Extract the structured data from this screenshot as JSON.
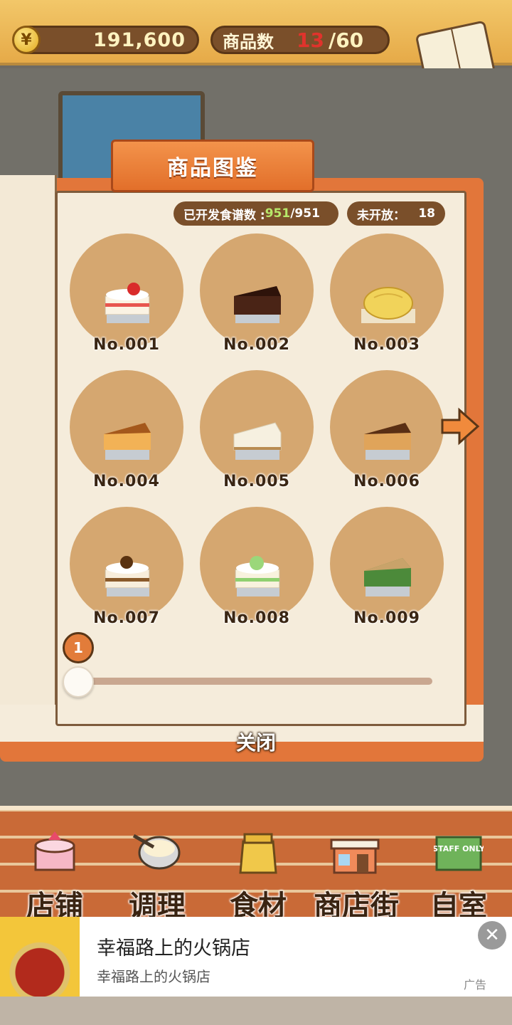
{
  "header": {
    "coin_value": "191,600",
    "coin_symbol": "¥",
    "item_label": "商品数",
    "item_current": "13",
    "item_max": "/60",
    "recipe_label": "食谱"
  },
  "book": {
    "title": "商品图鉴",
    "developed_label": "已开发食谱数 :",
    "developed_count": "951",
    "developed_total": "/951",
    "unopened_label": "未开放：",
    "unopened_count": "18",
    "page_number": "1",
    "close_label": "关闭",
    "items": [
      {
        "label": "No.001",
        "icon": "strawberry-shortcake-icon"
      },
      {
        "label": "No.002",
        "icon": "chocolate-cake-icon"
      },
      {
        "label": "No.003",
        "icon": "melon-pan-icon"
      },
      {
        "label": "No.004",
        "icon": "baked-cheesecake-icon"
      },
      {
        "label": "No.005",
        "icon": "rare-cheesecake-icon"
      },
      {
        "label": "No.006",
        "icon": "basque-cheesecake-icon"
      },
      {
        "label": "No.007",
        "icon": "chestnut-cake-icon"
      },
      {
        "label": "No.008",
        "icon": "melon-cake-icon"
      },
      {
        "label": "No.009",
        "icon": "matcha-cake-icon"
      }
    ]
  },
  "nav": {
    "items": [
      {
        "label": "店铺",
        "icon": "shop-cake-icon"
      },
      {
        "label": "调理",
        "icon": "cooking-bowl-icon"
      },
      {
        "label": "食材",
        "icon": "ingredient-bag-icon"
      },
      {
        "label": "商店街",
        "icon": "shopping-street-icon"
      },
      {
        "label": "自室",
        "icon": "staff-only-icon"
      }
    ],
    "staff_sign": "STAFF ONLY"
  },
  "ad": {
    "title": "幸福路上的火锅店",
    "subtitle": "幸福路上的火锅店",
    "tag": "广告"
  },
  "colors": {
    "accent": "#e2763a",
    "pill": "#7a4f2a",
    "highlight_green": "#b7e86a",
    "count_red": "#e0332c"
  }
}
